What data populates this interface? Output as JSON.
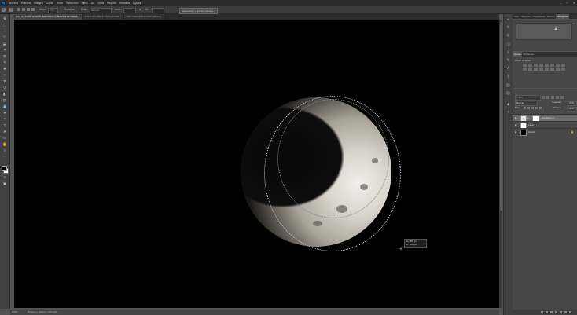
{
  "app": {
    "logo": "Ps"
  },
  "menubar": {
    "items": [
      "Archivo",
      "Edición",
      "Imagen",
      "Capa",
      "Texto",
      "Selección",
      "Filtro",
      "3D",
      "Vista",
      "Plugins",
      "Ventana",
      "Ayuda"
    ]
  },
  "window_controls": {
    "minimize": "–",
    "maximize": "□",
    "close": "✕"
  },
  "options_bar": {
    "feather_label": "Desv.:",
    "feather_value": "0 px",
    "antialias_label": "Suavizar",
    "style_label": "Estilo:",
    "style_value": "Normal",
    "width_label": "Anch.:",
    "height_label": "Alt.:",
    "select_mask_button": "Seleccionar y aplicar máscara..."
  },
  "document_tabs": [
    {
      "label": "DSC7153-HDR al 100% (Exposición 1, Máscara de capa/8) *",
      "active": true
    },
    {
      "label": "DSC7157-HDR al 100% (RGB/8) *",
      "active": false
    },
    {
      "label": "DSC7153-HDR al 100% (RGB/8) *",
      "active": false
    }
  ],
  "toolbar": {
    "tools": [
      "move-tool",
      "artboard",
      "marquee",
      "lasso",
      "object-select",
      "crop",
      "frame",
      "eyedropper",
      "healing",
      "brush",
      "clone-stamp",
      "history-brush",
      "eraser",
      "gradient",
      "blur",
      "dodge",
      "pen",
      "type",
      "path-select",
      "rectangle",
      "hand",
      "zoom",
      "more"
    ]
  },
  "status": {
    "zoom": "100%",
    "doc_info": "6240 px x 4160 px (300 ppi)"
  },
  "canvas": {
    "readout": {
      "w_label": "An.:",
      "w_value": "380 px",
      "h_label": "Al.:",
      "h_value": "3648 px"
    }
  },
  "panels": {
    "top_tabs": [
      "Color",
      "Muestras",
      "Degradados",
      "Motivos",
      "Histograma"
    ],
    "histogram_active": "Histograma",
    "adjust_tabs": [
      "Ajustes",
      "Bibliotecas"
    ],
    "adjust_label": "Añadir un ajuste",
    "layers_tabs": [
      "Capas",
      "Canales",
      "Trazados"
    ],
    "layers": {
      "search_placeholder": "Tipo",
      "blend_mode": "Normal",
      "opacity_label": "Opacidad:",
      "opacity_value": "100%",
      "fill_label": "Relleno:",
      "fill_value": "100%",
      "lock_label": "Bloq.:",
      "items": [
        {
          "name": "Exposición 1",
          "type": "adjustment",
          "selected": true
        },
        {
          "name": "Capa 1",
          "type": "image-white",
          "selected": false
        },
        {
          "name": "Fondo",
          "type": "image-black",
          "selected": false
        }
      ]
    }
  },
  "colors": {
    "accent": "#31a8ff",
    "ui_dark": "#2b2b2b",
    "canvas": "#000000"
  }
}
